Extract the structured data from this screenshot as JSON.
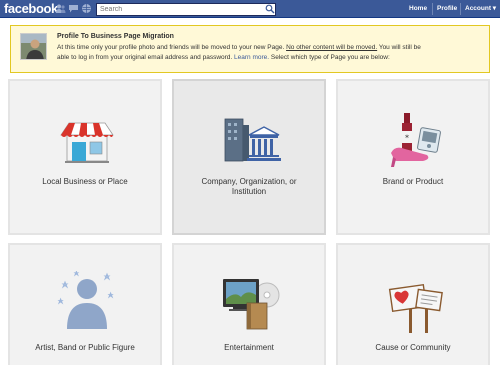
{
  "topbar": {
    "logo": "facebook",
    "search": {
      "placeholder": "Search",
      "value": ""
    },
    "nav": [
      "Home",
      "Profile",
      "Account ▾"
    ]
  },
  "notice": {
    "title": "Profile To Business Page Migration",
    "line1_a": "At this time only your profile photo and friends will be moved to your new Page. ",
    "line1_u": "No other content will be moved.",
    "line1_b": " You will still be",
    "line2_a": "able to log in from your original email address and password. ",
    "line2_link": "Learn more.",
    "line2_b": " Select which type of Page you are below:"
  },
  "categories": [
    {
      "line1": "Local Business or Place",
      "line2": ""
    },
    {
      "line1": "Company, Organization, or",
      "line2": "Institution"
    },
    {
      "line1": "Brand or Product",
      "line2": ""
    },
    {
      "line1": "Artist, Band or Public Figure",
      "line2": ""
    },
    {
      "line1": "Entertainment",
      "line2": ""
    },
    {
      "line1": "Cause or Community",
      "line2": ""
    }
  ],
  "colors": {
    "brand": "#3b5998",
    "notice_bg": "#fff9d7",
    "notice_border": "#e2c822"
  },
  "icons": [
    "storefront-icon",
    "office-buildings-icon",
    "wine-bottle-shoe-icon",
    "person-silhouette-icon",
    "tv-film-book-icon",
    "protest-signs-icon"
  ]
}
